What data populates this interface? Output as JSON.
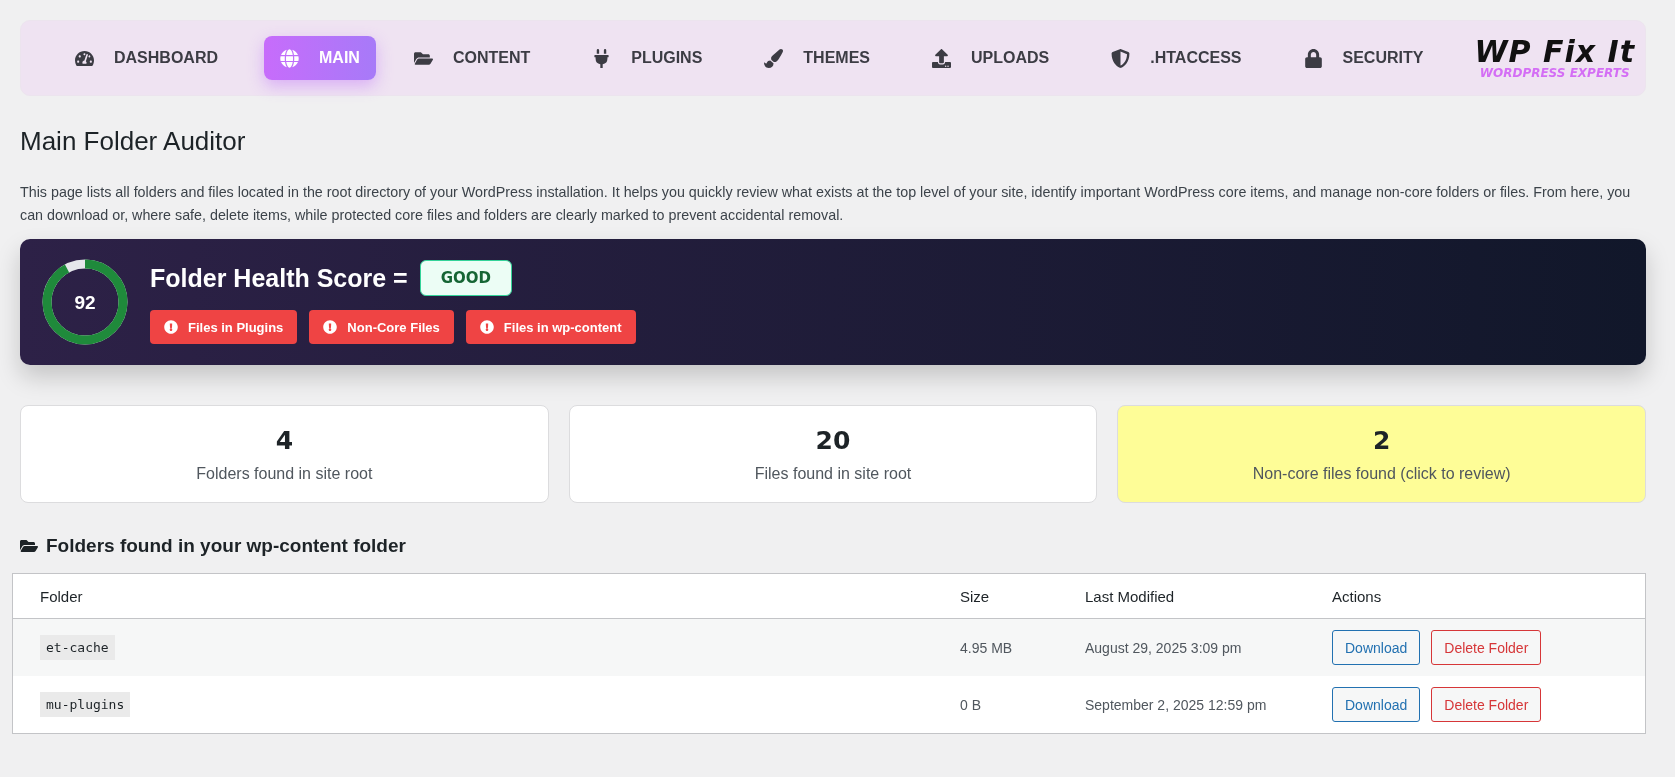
{
  "nav": {
    "items": [
      {
        "label": "DASHBOARD",
        "kind": "dashboard",
        "selected": false
      },
      {
        "label": "MAIN",
        "kind": "main",
        "selected": true
      },
      {
        "label": "CONTENT",
        "kind": "content",
        "selected": false
      },
      {
        "label": "PLUGINS",
        "kind": "plugins",
        "selected": false
      },
      {
        "label": "THEMES",
        "kind": "themes",
        "selected": false
      },
      {
        "label": "UPLOADS",
        "kind": "uploads",
        "selected": false
      },
      {
        "label": ".HTACCESS",
        "kind": "htaccess",
        "selected": false
      },
      {
        "label": "SECURITY",
        "kind": "security",
        "selected": false
      }
    ],
    "logo": {
      "title": "WP Fix It",
      "subtitle": "WORDPRESS EXPERTS"
    }
  },
  "page": {
    "title": "Main Folder Auditor",
    "description": "This page lists all folders and files located in the root directory of your WordPress installation. It helps you quickly review what exists at the top level of your site, identify important WordPress core items, and manage non-core folders or files. From here, you can download or, where safe, delete items, while protected core files and folders are clearly marked to prevent accidental removal."
  },
  "health": {
    "score": "92",
    "level": 0.92,
    "title": "Folder Health Score =",
    "status": "GOOD",
    "warnings": [
      "Files in Plugins",
      "Non-Core Files",
      "Files in wp-content"
    ]
  },
  "stats": [
    {
      "value": "4",
      "label": "Folders found in site root",
      "highlighted": false
    },
    {
      "value": "20",
      "label": "Files found in site root",
      "highlighted": false
    },
    {
      "value": "2",
      "label": "Non-core files found (click to review)",
      "highlighted": true
    }
  ],
  "folders": {
    "heading": "Folders found in your wp-content folder",
    "columns": [
      "Folder",
      "Size",
      "Last Modified",
      "Actions"
    ],
    "rows": [
      {
        "name": "et-cache",
        "size": "4.95 MB",
        "modified": "August 29, 2025 3:09 pm",
        "actions": [
          "Download",
          "Delete Folder"
        ]
      },
      {
        "name": "mu-plugins",
        "size": "0 B",
        "modified": "September 2, 2025 12:59 pm",
        "actions": [
          "Download",
          "Delete Folder"
        ]
      }
    ]
  }
}
